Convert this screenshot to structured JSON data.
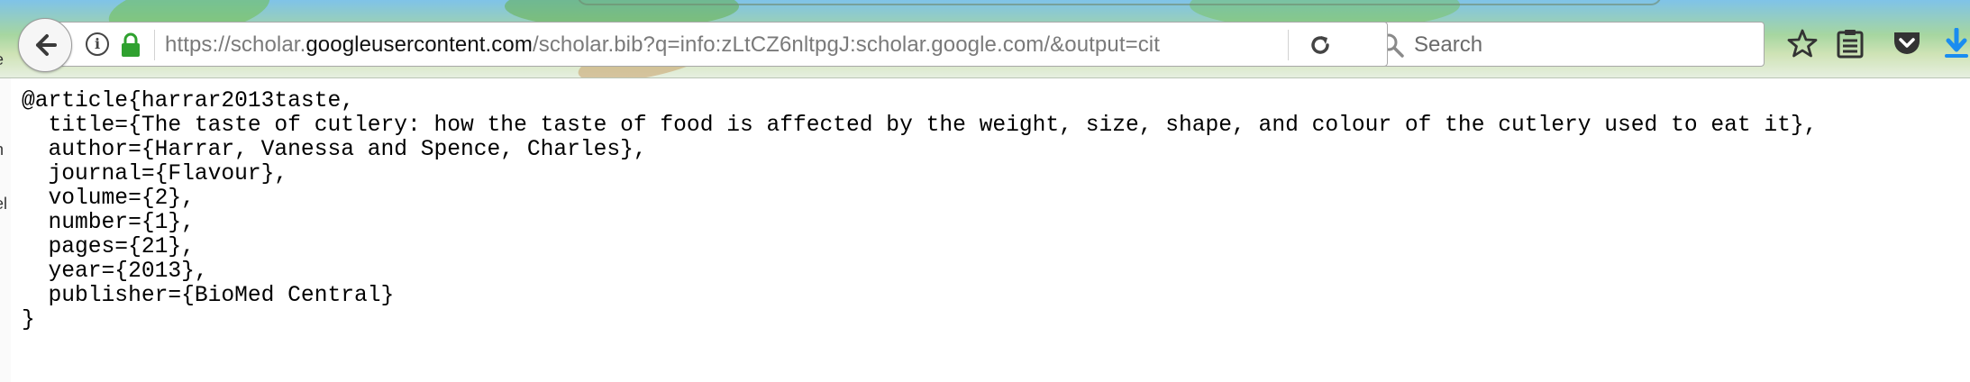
{
  "browser": {
    "url_scheme": "https://scholar.",
    "url_domain": "googleusercontent.com",
    "url_path": "/scholar.bib?q=info:zLtCZ6nltpgJ:scholar.google.com/&output=cit",
    "search_placeholder": "Search"
  },
  "icons": {
    "back": "back-arrow-icon",
    "info": "info-icon",
    "lock": "lock-icon",
    "reload": "reload-icon",
    "search": "search-icon",
    "bookmark": "star-icon",
    "reader": "clipboard-icon",
    "pocket": "pocket-icon",
    "download": "download-icon"
  },
  "colors": {
    "accent_blue": "#1a8cf0",
    "lock_green": "#2fa12f"
  },
  "side_glimpse": [
    "e",
    "h",
    "el"
  ],
  "bibtex": {
    "lines": [
      "@article{harrar2013taste,",
      "  title={The taste of cutlery: how the taste of food is affected by the weight, size, shape, and colour of the cutlery used to eat it},",
      "  author={Harrar, Vanessa and Spence, Charles},",
      "  journal={Flavour},",
      "  volume={2},",
      "  number={1},",
      "  pages={21},",
      "  year={2013},",
      "  publisher={BioMed Central}",
      "}"
    ]
  }
}
